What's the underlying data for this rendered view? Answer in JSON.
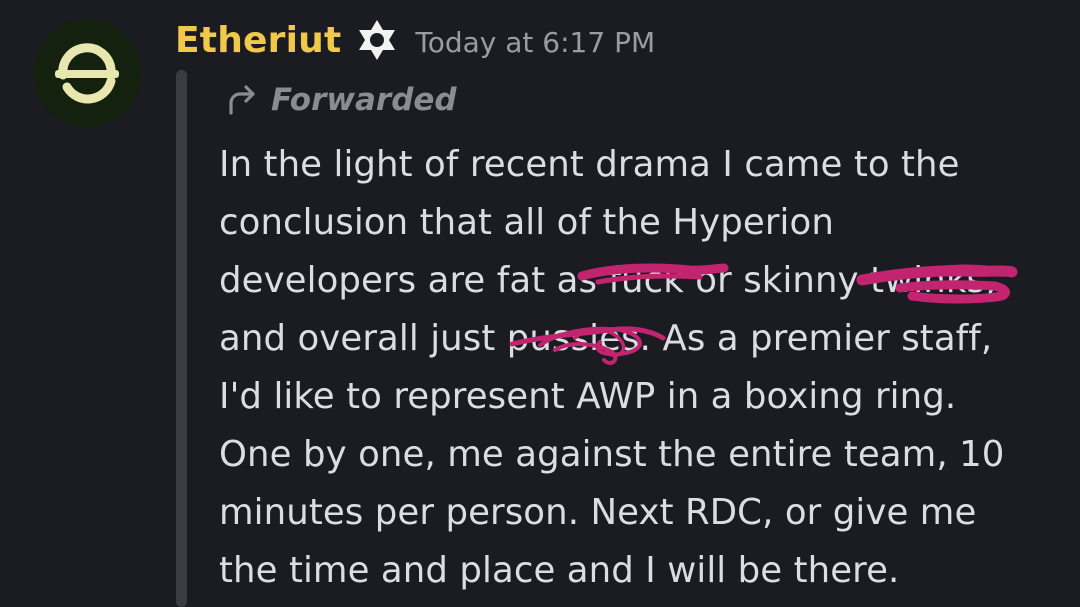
{
  "message": {
    "author": "Etheriut",
    "timestamp": "Today at 6:17 PM",
    "forwarded_label": "Forwarded",
    "lines": [
      "In the light of recent drama I came to the",
      "conclusion that all of the Hyperion",
      "developers are fat as fuck or skinny twinks,",
      "and overall just pussies. As a premier staff,",
      "I'd like to represent AWP in a boxing ring.",
      "One by one, me against the entire team, 10",
      "minutes per person. Next RDC, or give me",
      "the time and place and I will be there."
    ]
  },
  "colors": {
    "background": "#1b1c21",
    "username": "#f0c94a",
    "text": "#dcdde2",
    "muted": "#9b9ca3",
    "scribble": "#c2246f",
    "avatar_bg": "#14210f",
    "avatar_logo": "#e9e7b0"
  },
  "icons": {
    "avatar": "server-logo-icon",
    "badge": "star-badge-icon",
    "forward": "forward-arrow-icon"
  }
}
